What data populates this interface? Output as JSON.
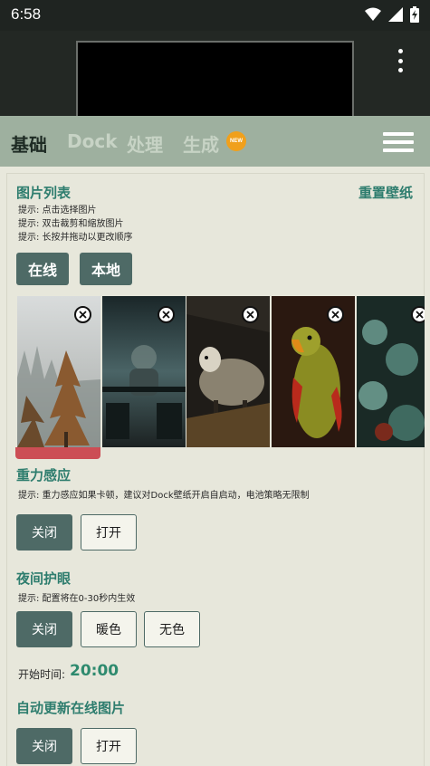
{
  "status": {
    "time": "6:58"
  },
  "tabs": [
    {
      "label": "基础"
    },
    {
      "label": "Dock"
    },
    {
      "label": "处理"
    },
    {
      "label": "生成"
    }
  ],
  "new_badge": "NEW",
  "image_list": {
    "title": "图片列表",
    "reset_label": "重置壁纸",
    "hints": [
      "提示: 点击选择图片",
      "提示: 双击裁剪和缩放图片",
      "提示: 长按并拖动以更改顺序"
    ],
    "buttons": {
      "online": "在线",
      "local": "本地"
    }
  },
  "gravity": {
    "title": "重力感应",
    "hint": "提示: 重力感应如果卡顿，建议对Dock壁纸开启自启动，电池策略无限制",
    "off": "关闭",
    "on": "打开"
  },
  "night": {
    "title": "夜间护眼",
    "hint": "提示: 配置将在0-30秒内生效",
    "off": "关闭",
    "warm": "暖色",
    "none": "无色",
    "start_label": "开始时间:",
    "start_time": "20:00"
  },
  "auto_update": {
    "title": "自动更新在线图片",
    "off": "关闭",
    "on": "打开"
  },
  "colors": {
    "accent": "#2e7d6e",
    "dark_button": "#4e6a66",
    "tabbar": "#9eb09f",
    "selected": "#cc4e55"
  },
  "icons": [
    "wifi-icon",
    "signal-icon",
    "battery-icon",
    "more-icon",
    "menu-icon",
    "close-icon"
  ]
}
